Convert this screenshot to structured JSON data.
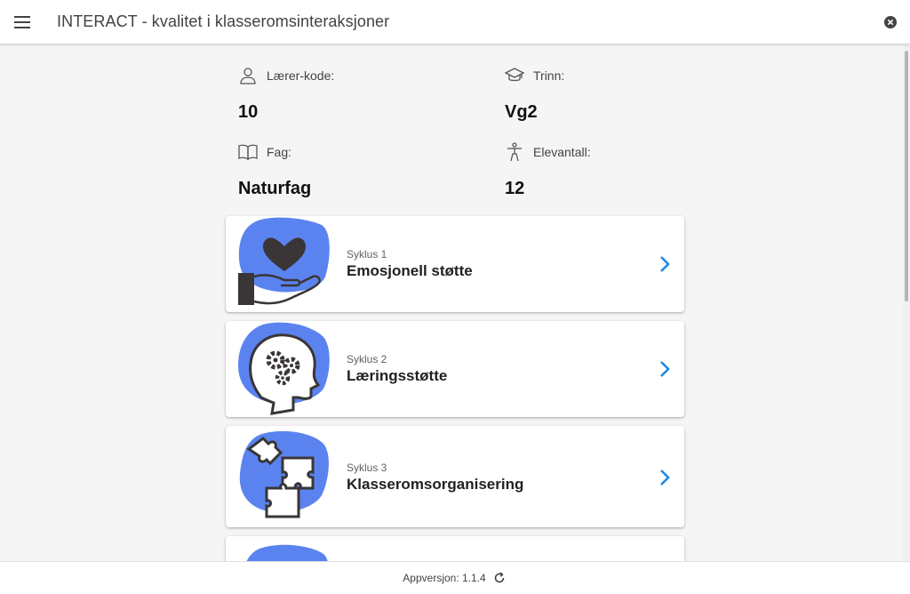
{
  "header": {
    "title": "INTERACT - kvalitet i klasseromsinteraksjoner",
    "menu_icon": "hamburger-menu-icon",
    "close_icon": "close-circle-icon"
  },
  "info": {
    "teacher_code": {
      "label": "Lærer-kode:",
      "value": "10",
      "icon": "person-icon"
    },
    "grade": {
      "label": "Trinn:",
      "value": "Vg2",
      "icon": "graduation-cap-icon"
    },
    "subject": {
      "label": "Fag:",
      "value": "Naturfag",
      "icon": "book-icon"
    },
    "student_count": {
      "label": "Elevantall:",
      "value": "12",
      "icon": "person-figure-icon"
    }
  },
  "cycles": [
    {
      "subtitle": "Syklus 1",
      "title": "Emosjonell støtte",
      "icon": "heart-hand-icon"
    },
    {
      "subtitle": "Syklus 2",
      "title": "Læringsstøtte",
      "icon": "head-gears-icon"
    },
    {
      "subtitle": "Syklus 3",
      "title": "Klasseromsorganisering",
      "icon": "puzzle-pieces-icon"
    }
  ],
  "footer": {
    "version_text": "Appversjon: 1.1.4",
    "refresh_icon": "refresh-icon"
  },
  "colors": {
    "accent": "#1e88e5",
    "blob": "#5b83f0",
    "illustration_stroke": "#3a3536"
  }
}
